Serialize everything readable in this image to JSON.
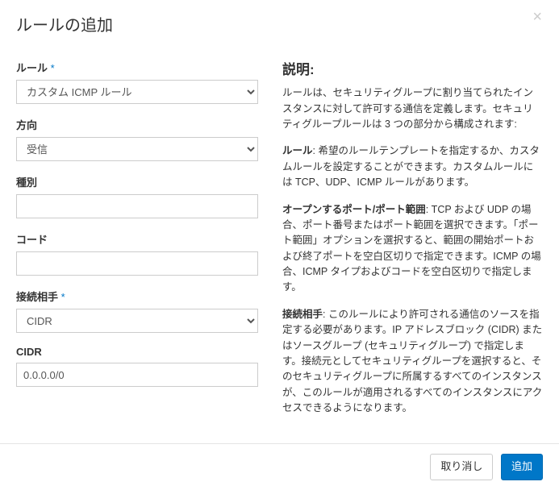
{
  "modal": {
    "title": "ルールの追加",
    "close_label": "×"
  },
  "form": {
    "rule": {
      "label": "ルール",
      "value": "カスタム ICMP ルール"
    },
    "direction": {
      "label": "方向",
      "value": "受信"
    },
    "type_field": {
      "label": "種別",
      "value": ""
    },
    "code": {
      "label": "コード",
      "value": ""
    },
    "remote": {
      "label": "接続相手",
      "value": "CIDR"
    },
    "cidr": {
      "label": "CIDR",
      "value": "0.0.0.0/0"
    }
  },
  "description": {
    "header": "説明:",
    "intro": "ルールは、セキュリティグループに割り当てられたインスタンスに対して許可する通信を定義します。セキュリティグループルールは 3 つの部分から構成されます:",
    "rule_b": "ルール",
    "rule_t": ": 希望のルールテンプレートを指定するか、カスタムルールを設定することができます。カスタムルールには TCP、UDP、ICMP ルールがあります。",
    "port_b": "オープンするポート/ポート範囲",
    "port_t": ": TCP および UDP の場合、ポート番号またはポート範囲を選択できます。「ポート範囲」オプションを選択すると、範囲の開始ポートおよび終了ポートを空白区切りで指定できます。ICMP の場合、ICMP タイプおよびコードを空白区切りで指定します。",
    "remote_b": "接続相手",
    "remote_t": ": このルールにより許可される通信のソースを指定する必要があります。IP アドレスブロック (CIDR) またはソースグループ (セキュリティグループ) で指定します。接続元としてセキュリティグループを選択すると、そのセキュリティグループに所属するすべてのインスタンスが、このルールが適用されるすべてのインスタンスにアクセスできるようになります。"
  },
  "footer": {
    "cancel": "取り消し",
    "submit": "追加"
  }
}
